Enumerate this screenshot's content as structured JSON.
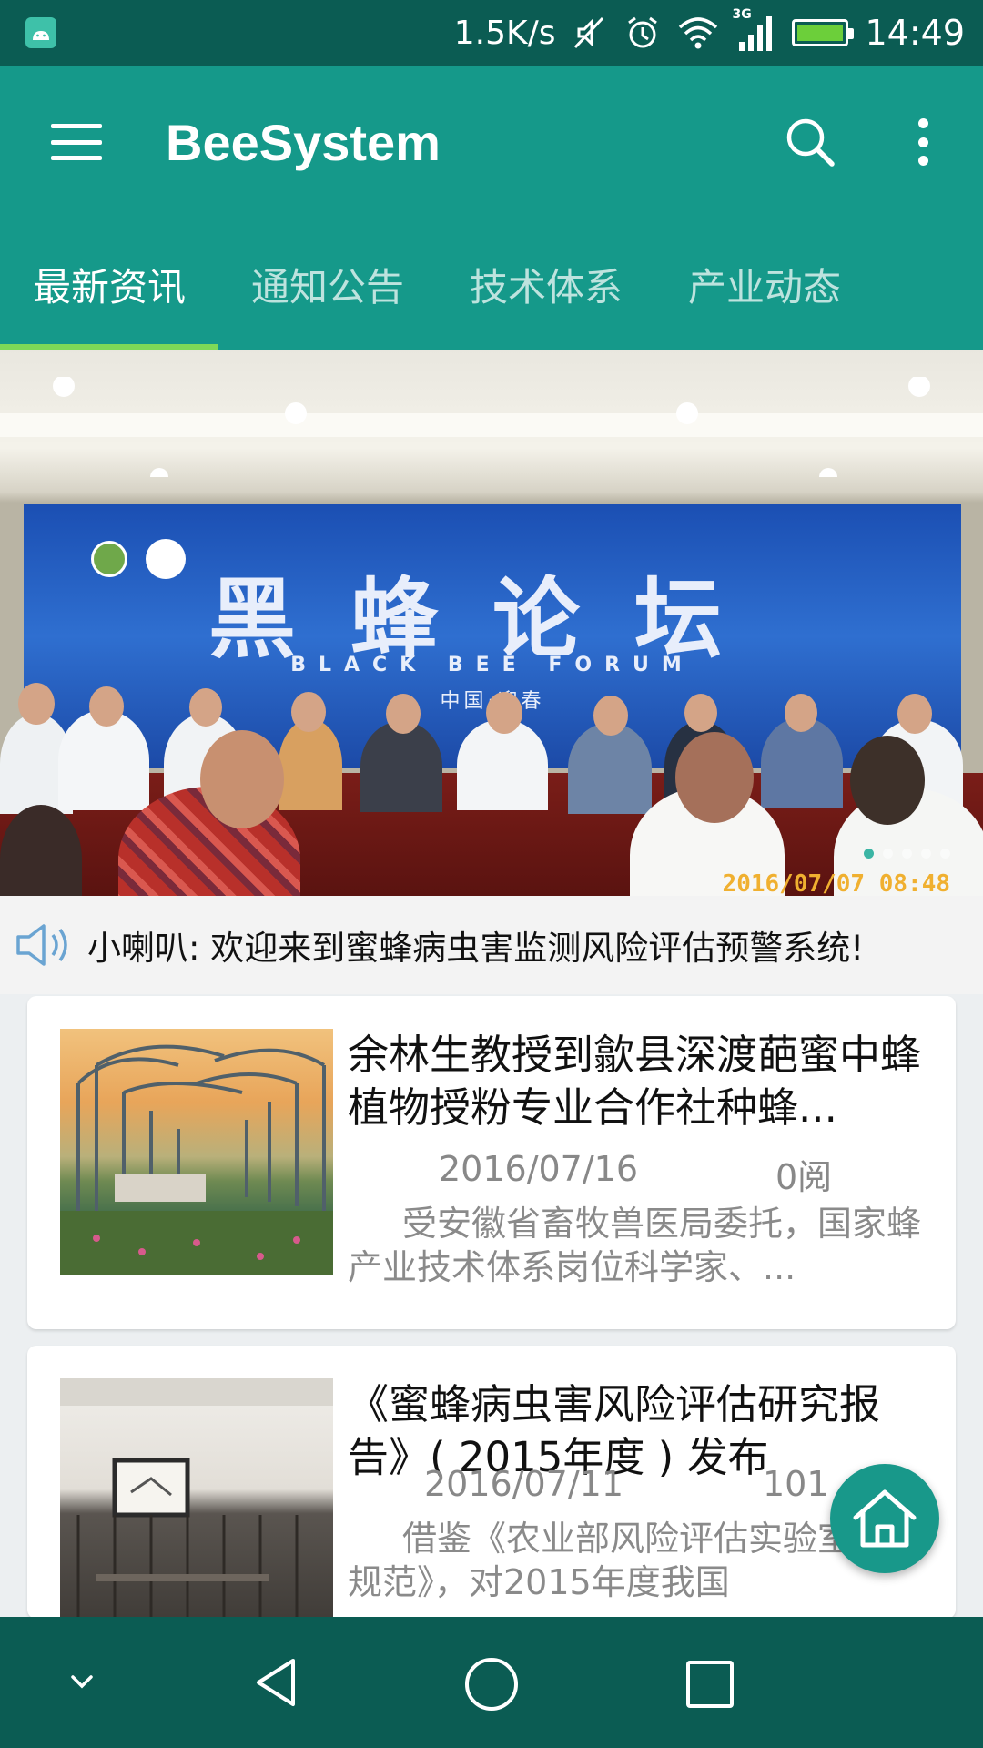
{
  "status_bar": {
    "network_speed": "1.5K/s",
    "network_type": "3G",
    "time": "14:49",
    "icons": [
      "android-icon",
      "mute-icon",
      "alarm-icon",
      "wifi-icon",
      "signal-icon",
      "battery-icon"
    ]
  },
  "app_bar": {
    "title": "BeeSystem",
    "icons": [
      "menu-icon",
      "search-icon",
      "more-vert-icon"
    ]
  },
  "tabs": [
    {
      "label": "最新资讯",
      "active": true
    },
    {
      "label": "通知公告",
      "active": false
    },
    {
      "label": "技术体系",
      "active": false
    },
    {
      "label": "产业动态",
      "active": false
    }
  ],
  "banner": {
    "backdrop_title": "黑蜂论坛",
    "backdrop_subtitle": "BLACK BEE FORUM",
    "backdrop_location": "中国·迎春",
    "timestamp": "2016/07/07 08:48",
    "slides": 5,
    "active_slide": 1
  },
  "notice": {
    "icon": "speaker-icon",
    "text": "小喇叭: 欢迎来到蜜蜂病虫害监测风险评估预警系统!"
  },
  "articles": [
    {
      "title": "余林生教授到歙县深渡葩蜜中蜂植物授粉专业合作社种蜂...",
      "date": "2016/07/16",
      "reads": "0阅",
      "summary": "受安徽省畜牧兽医局委托，国家蜂产业技术体系岗位科学家、..."
    },
    {
      "title": "《蜜蜂病虫害风险评估研究报告》( 2015年度 ) 发布",
      "date": "2016/07/11",
      "reads": "101",
      "summary": "借鉴《农业部风险评估实验室管理规范》，对2015年度我国"
    }
  ],
  "colors": {
    "primary": "#15998a",
    "primary_dark": "#0b5c53",
    "tab_indicator": "#7ed957",
    "fab": "#18988a"
  },
  "fab": {
    "icon": "home-icon"
  },
  "nav_bar": {
    "icons": [
      "hide-keyboard-icon",
      "back-icon",
      "home-circle-icon",
      "recents-icon"
    ]
  }
}
